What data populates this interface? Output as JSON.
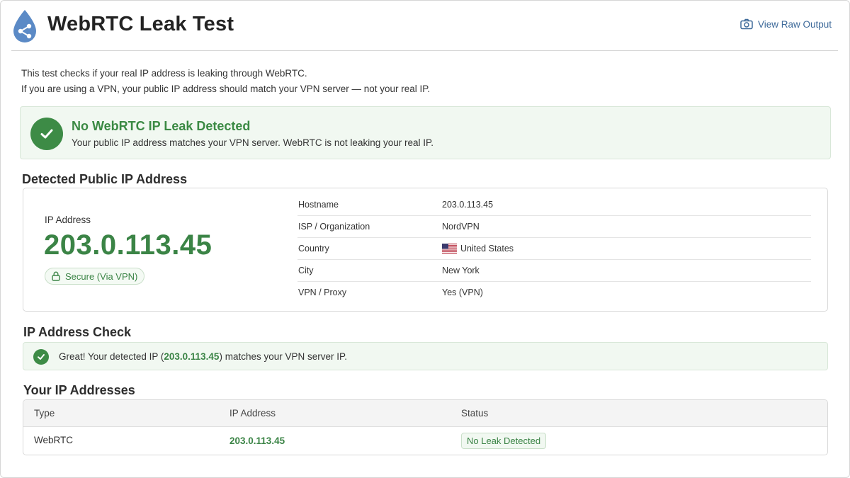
{
  "header": {
    "title": "WebRTC Leak Test",
    "raw_output_label": "View Raw Output"
  },
  "intro": {
    "line1": "This test checks if your real IP address is leaking through WebRTC.",
    "line2": "If you are using a VPN, your public IP address should match your VPN server — not your real IP."
  },
  "alert": {
    "title": "No WebRTC IP Leak Detected",
    "text": "Your public IP address matches your VPN server. WebRTC is not leaking your real IP."
  },
  "detected": {
    "section_title": "Detected Public IP Address",
    "ip_label": "IP Address",
    "ip": "203.0.113.45",
    "secure_label": "Secure (Via VPN)",
    "details": [
      {
        "key": "Hostname",
        "value": "203.0.113.45"
      },
      {
        "key": "ISP / Organization",
        "value": "NordVPN"
      },
      {
        "key": "Country",
        "value": "United States",
        "flag": "us-flag-icon"
      },
      {
        "key": "City",
        "value": "New York"
      },
      {
        "key": "VPN / Proxy",
        "value": "Yes (VPN)"
      }
    ]
  },
  "check": {
    "section_title": "IP Address Check",
    "text_before": "Great! Your detected IP (",
    "ip": "203.0.113.45",
    "text_after": ") matches your VPN server IP."
  },
  "addresses": {
    "section_title": "Your IP Addresses",
    "columns": [
      "Type",
      "IP Address",
      "Status"
    ],
    "rows": [
      {
        "type": "WebRTC",
        "ip": "203.0.113.45",
        "status": "No Leak Detected"
      }
    ]
  },
  "colors": {
    "success_green": "#3d8b46",
    "link_blue": "#3e6a9a",
    "logo_blue": "#5b8ac6"
  }
}
